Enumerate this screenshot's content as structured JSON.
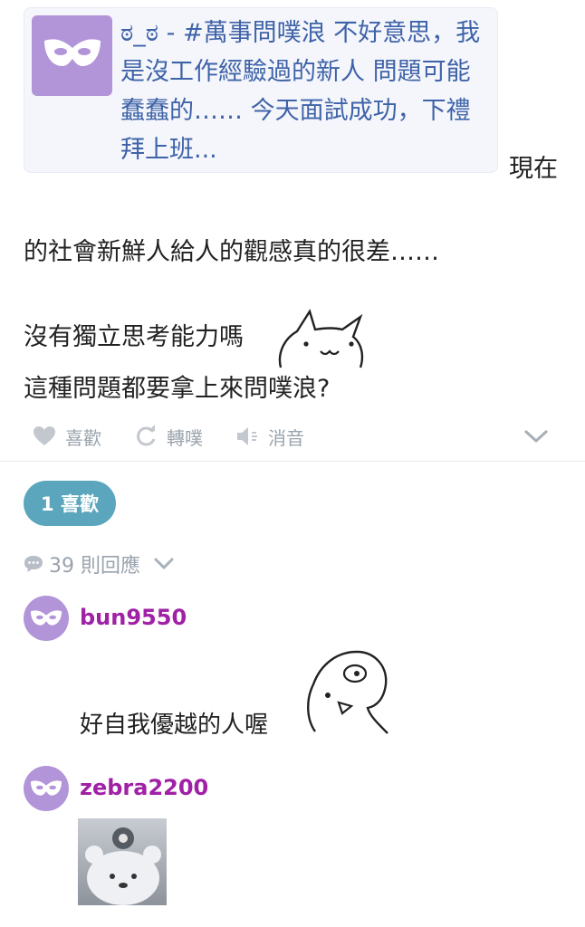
{
  "quote": {
    "title": "ಠ_ಠ - #萬事問噗浪 不好意思，我是沒工作經驗過的新人 問題可能蠢蠢的…… 今天面試成功，下禮拜上班..."
  },
  "post": {
    "line_1": "現在",
    "line_2": "的社會新鮮人給人的觀感真的很差……",
    "line_3": "沒有獨立思考能力嗎",
    "line_4": "這種問題都要拿上來問噗浪?"
  },
  "actions": {
    "like": "喜歡",
    "replurk": "轉噗",
    "mute": "消音"
  },
  "likes_badge": "1 喜歡",
  "replies": {
    "count_label": "39 則回應"
  },
  "comments": [
    {
      "username": "bun9550",
      "text": "好自我優越的人喔"
    },
    {
      "username": "zebra2200"
    }
  ],
  "colors": {
    "mask_avatar_bg": "#b294d8",
    "link": "#3f63a8",
    "username": "#a020a6",
    "like_pill": "#5ba6bd",
    "muted": "#9aa3ad"
  }
}
